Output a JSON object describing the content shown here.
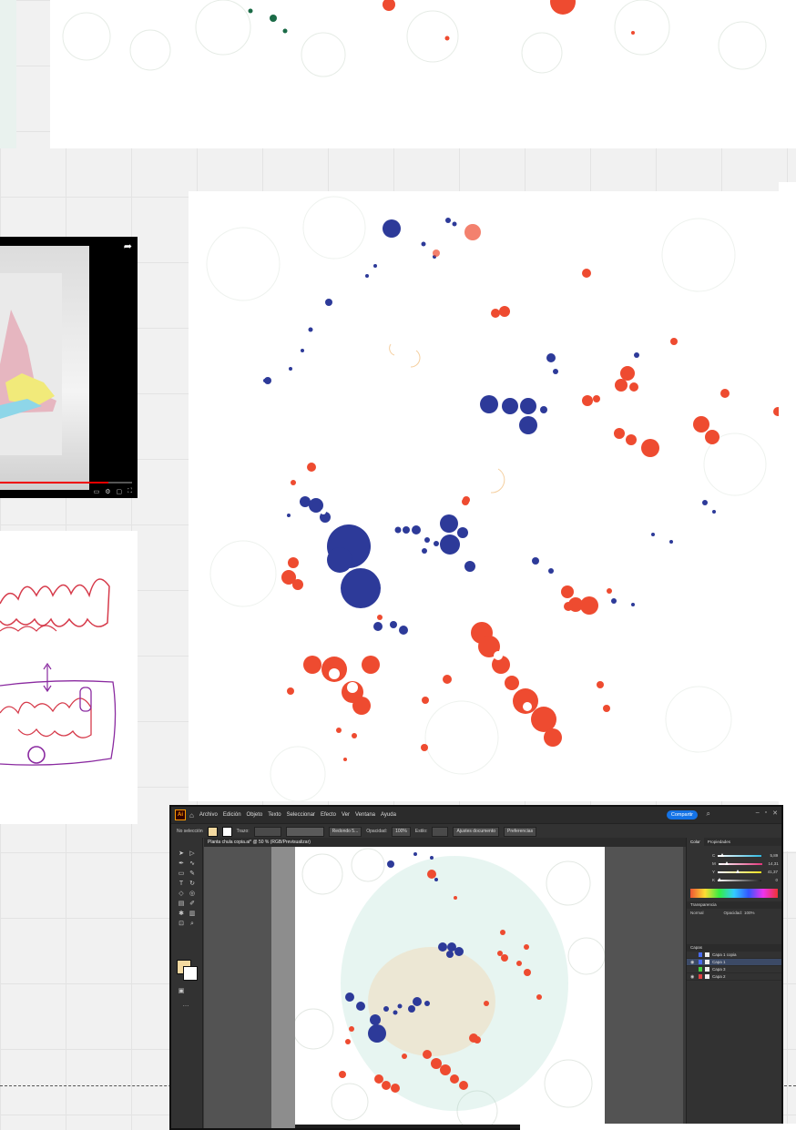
{
  "illustrator": {
    "app_logo": "Ai",
    "menu": [
      "Archivo",
      "Edición",
      "Objeto",
      "Texto",
      "Seleccionar",
      "Efecto",
      "Ver",
      "Ventana",
      "Ayuda"
    ],
    "share_label": "Compartir",
    "control_bar": {
      "selection": "No selección",
      "stroke_label": "Trazo:",
      "brush": "Redondo 5...",
      "opacity_label": "Opacidad:",
      "opacity_value": "100%",
      "style_label": "Estilo:",
      "doc_setup": "Ajustes documento",
      "preferences": "Preferencias"
    },
    "document_tab": "Planta chula copia.ai* @ 50 % (RGB/Previsualizar)",
    "panels": {
      "tabs": [
        "Color",
        "Propiedades"
      ],
      "color_sliders": [
        {
          "channel": "C",
          "value": "5,89",
          "color": "#2fb8e0",
          "level": 0.06
        },
        {
          "channel": "M",
          "value": "14,31",
          "color": "#e0357a",
          "level": 0.14
        },
        {
          "channel": "Y",
          "value": "41,37",
          "color": "#f3e020",
          "level": 0.41
        },
        {
          "channel": "K",
          "value": "0",
          "color": "#222222",
          "level": 0.0
        }
      ],
      "transparency_title": "Transparencia",
      "blend_mode": "Normal",
      "opacity_label": "Opacidad:",
      "opacity_value": "100%",
      "layers_title": "Capas",
      "layers": [
        {
          "name": "Capa 1 copia",
          "color": "#4a6cf0"
        },
        {
          "name": "Capa 1",
          "color": "#4a6cf0"
        },
        {
          "name": "Capa 3",
          "color": "#45d045"
        },
        {
          "name": "Capa 2",
          "color": "#e04040"
        }
      ]
    }
  },
  "colors": {
    "blue": "#2d3a99",
    "red": "#ee4b30",
    "teal": "#9fd6c8",
    "peach": "#f5cf9f"
  }
}
